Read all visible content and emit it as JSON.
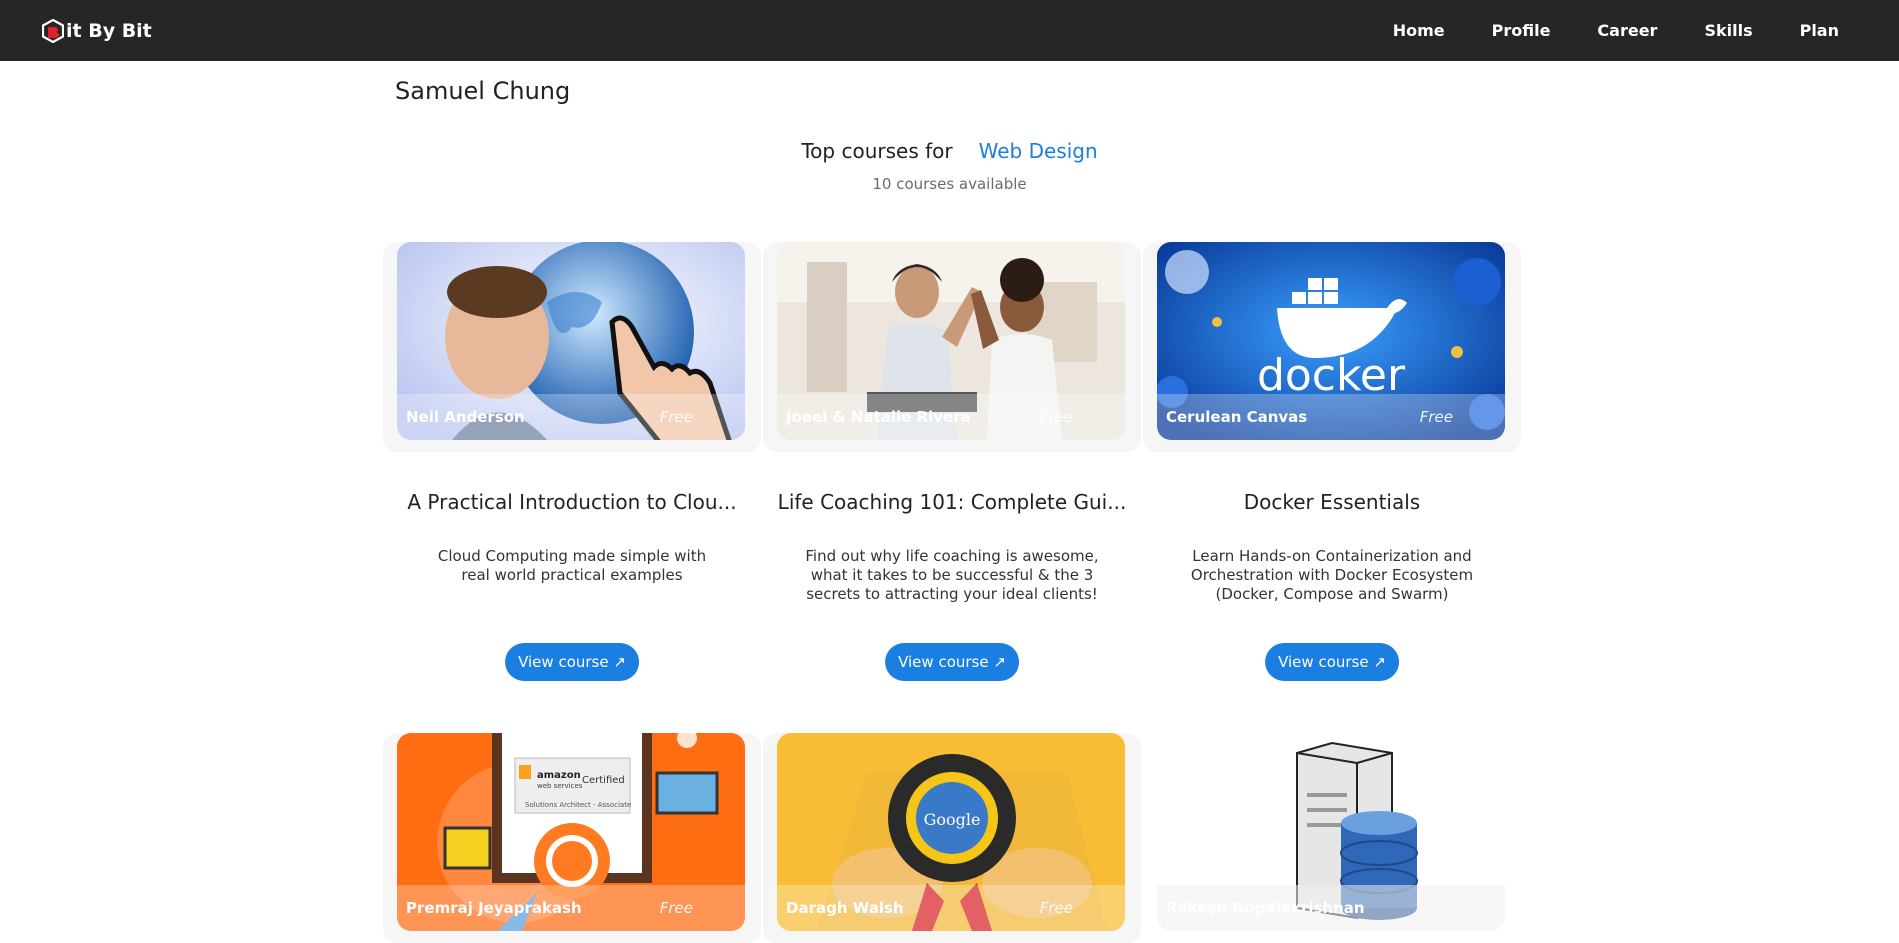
{
  "brand": {
    "name": "it By Bit",
    "logo_icon": "cube-b-logo-icon",
    "accent": "#e0202e"
  },
  "nav": [
    "Home",
    "Profile",
    "Career",
    "Skills",
    "Plan"
  ],
  "user": {
    "name": "Samuel Chung"
  },
  "heading": {
    "prefix": "Top courses for",
    "topic": "Web Design",
    "count_text": "10 courses available"
  },
  "colors": {
    "primary": "#1a7fe0",
    "navbar": "#262626"
  },
  "courses": [
    {
      "instructor": "Neil Anderson",
      "price": "Free",
      "title": "A Practical Introduction to Clou...",
      "description": "Cloud Computing made simple with real world practical examples",
      "button": "View course ↗"
    },
    {
      "instructor": "Joeel & Natalie Rivera",
      "price": "Free",
      "title": "Life Coaching 101: Complete Gui...",
      "description": "Find out why life coaching is awesome, what it takes to be successful & the 3 secrets to attracting your ideal clients!",
      "button": "View course ↗"
    },
    {
      "instructor": "Cerulean Canvas",
      "price": "Free",
      "title": "Docker Essentials",
      "description": "Learn Hands-on Containerization and Orchestration with Docker Ecosystem (Docker, Compose and Swarm)",
      "button": "View course ↗"
    },
    {
      "instructor": "Premraj Jeyaprakash",
      "price": "Free"
    },
    {
      "instructor": "Daragh Walsh",
      "price": "Free"
    },
    {
      "instructor": "Rakesh Gopalakrishnan",
      "price": ""
    }
  ],
  "thumb_text": {
    "aws_brand": "amazon",
    "aws_sub": "web services",
    "aws_certified": "Certified",
    "aws_role": "Solutions Architect - Associate",
    "google_seal": "Google",
    "docker_word": "docker"
  }
}
